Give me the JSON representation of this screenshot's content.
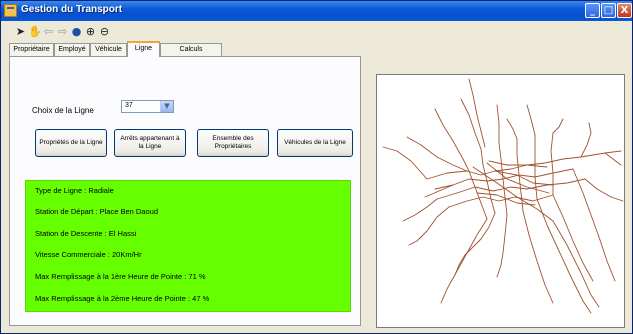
{
  "window": {
    "title": "Gestion du Transport",
    "controls": {
      "minimize": "_",
      "maximize": "□",
      "close": "X"
    }
  },
  "toolbar": {
    "tools": [
      {
        "name": "select-arrow-icon",
        "glyph": "➤"
      },
      {
        "name": "pan-hand-icon",
        "glyph": "✋"
      },
      {
        "name": "back-arrow-icon",
        "glyph": "⇦"
      },
      {
        "name": "forward-arrow-icon",
        "glyph": "⇨"
      },
      {
        "name": "globe-icon",
        "glyph": "●"
      },
      {
        "name": "zoom-in-icon",
        "glyph": "⊕"
      },
      {
        "name": "zoom-out-icon",
        "glyph": "⊖"
      }
    ]
  },
  "tabs": [
    {
      "label": "Propriétaire",
      "active": false
    },
    {
      "label": "Employé",
      "active": false
    },
    {
      "label": "Véhicule",
      "active": false
    },
    {
      "label": "Ligne",
      "active": true
    },
    {
      "label": "Calculs",
      "active": false
    }
  ],
  "line_tab": {
    "choice_label": "Choix de la Ligne",
    "selected_line": "37",
    "buttons": [
      "Propriétés de la Ligne",
      "Arrêts appartenant à la Ligne",
      "Ensemble des Propriétaires",
      "Véhicules de la Ligne"
    ],
    "info_lines": [
      "Type de Ligne : Radiale",
      "Station de Départ : Place Ben Daoud",
      "Station de Descente : El Hassi",
      "Vitesse Commerciale : 20Km/Hr",
      "Max Remplissage à la 1ère Heure de Pointe : 71 %",
      "Max Remplissage à la 2ème Heure de Pointe : 47 %"
    ],
    "info_color": "#66ff00"
  },
  "map": {
    "line_color": "#a0522d"
  }
}
